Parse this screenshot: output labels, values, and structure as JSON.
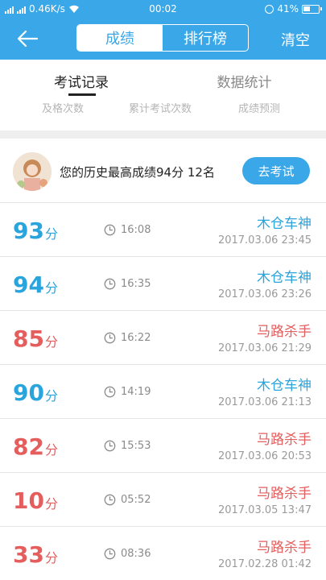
{
  "status_bar": {
    "speed": "0.46K/s",
    "time": "00:02",
    "battery": "41%"
  },
  "header": {
    "back_icon": "back-arrow-icon",
    "tabs": [
      {
        "label": "成绩",
        "active": true
      },
      {
        "label": "排行榜",
        "active": false
      }
    ],
    "clear_label": "清空",
    "accent": "#3aa7e8"
  },
  "tabs": {
    "record_label": "考试记录",
    "stats_label": "数据统计",
    "sub": [
      "及格次数",
      "累计考试次数",
      "成绩预测"
    ]
  },
  "best": {
    "text": "您的历史最高成绩94分  12名",
    "button_label": "去考试"
  },
  "records": [
    {
      "score": "93",
      "unit": "分",
      "duration": "16:08",
      "label": "木仓车神",
      "date": "2017.03.06  23:45",
      "color": "blue"
    },
    {
      "score": "94",
      "unit": "分",
      "duration": "16:35",
      "label": "木仓车神",
      "date": "2017.03.06  23:26",
      "color": "blue"
    },
    {
      "score": "85",
      "unit": "分",
      "duration": "16:22",
      "label": "马路杀手",
      "date": "2017.03.06  21:29",
      "color": "red"
    },
    {
      "score": "90",
      "unit": "分",
      "duration": "14:19",
      "label": "木仓车神",
      "date": "2017.03.06  21:13",
      "color": "blue"
    },
    {
      "score": "82",
      "unit": "分",
      "duration": "15:53",
      "label": "马路杀手",
      "date": "2017.03.06  20:53",
      "color": "red"
    },
    {
      "score": "10",
      "unit": "分",
      "duration": "05:52",
      "label": "马路杀手",
      "date": "2017.03.05  13:47",
      "color": "red"
    },
    {
      "score": "33",
      "unit": "分",
      "duration": "08:36",
      "label": "马路杀手",
      "date": "2017.02.28  01:42",
      "color": "red"
    }
  ]
}
